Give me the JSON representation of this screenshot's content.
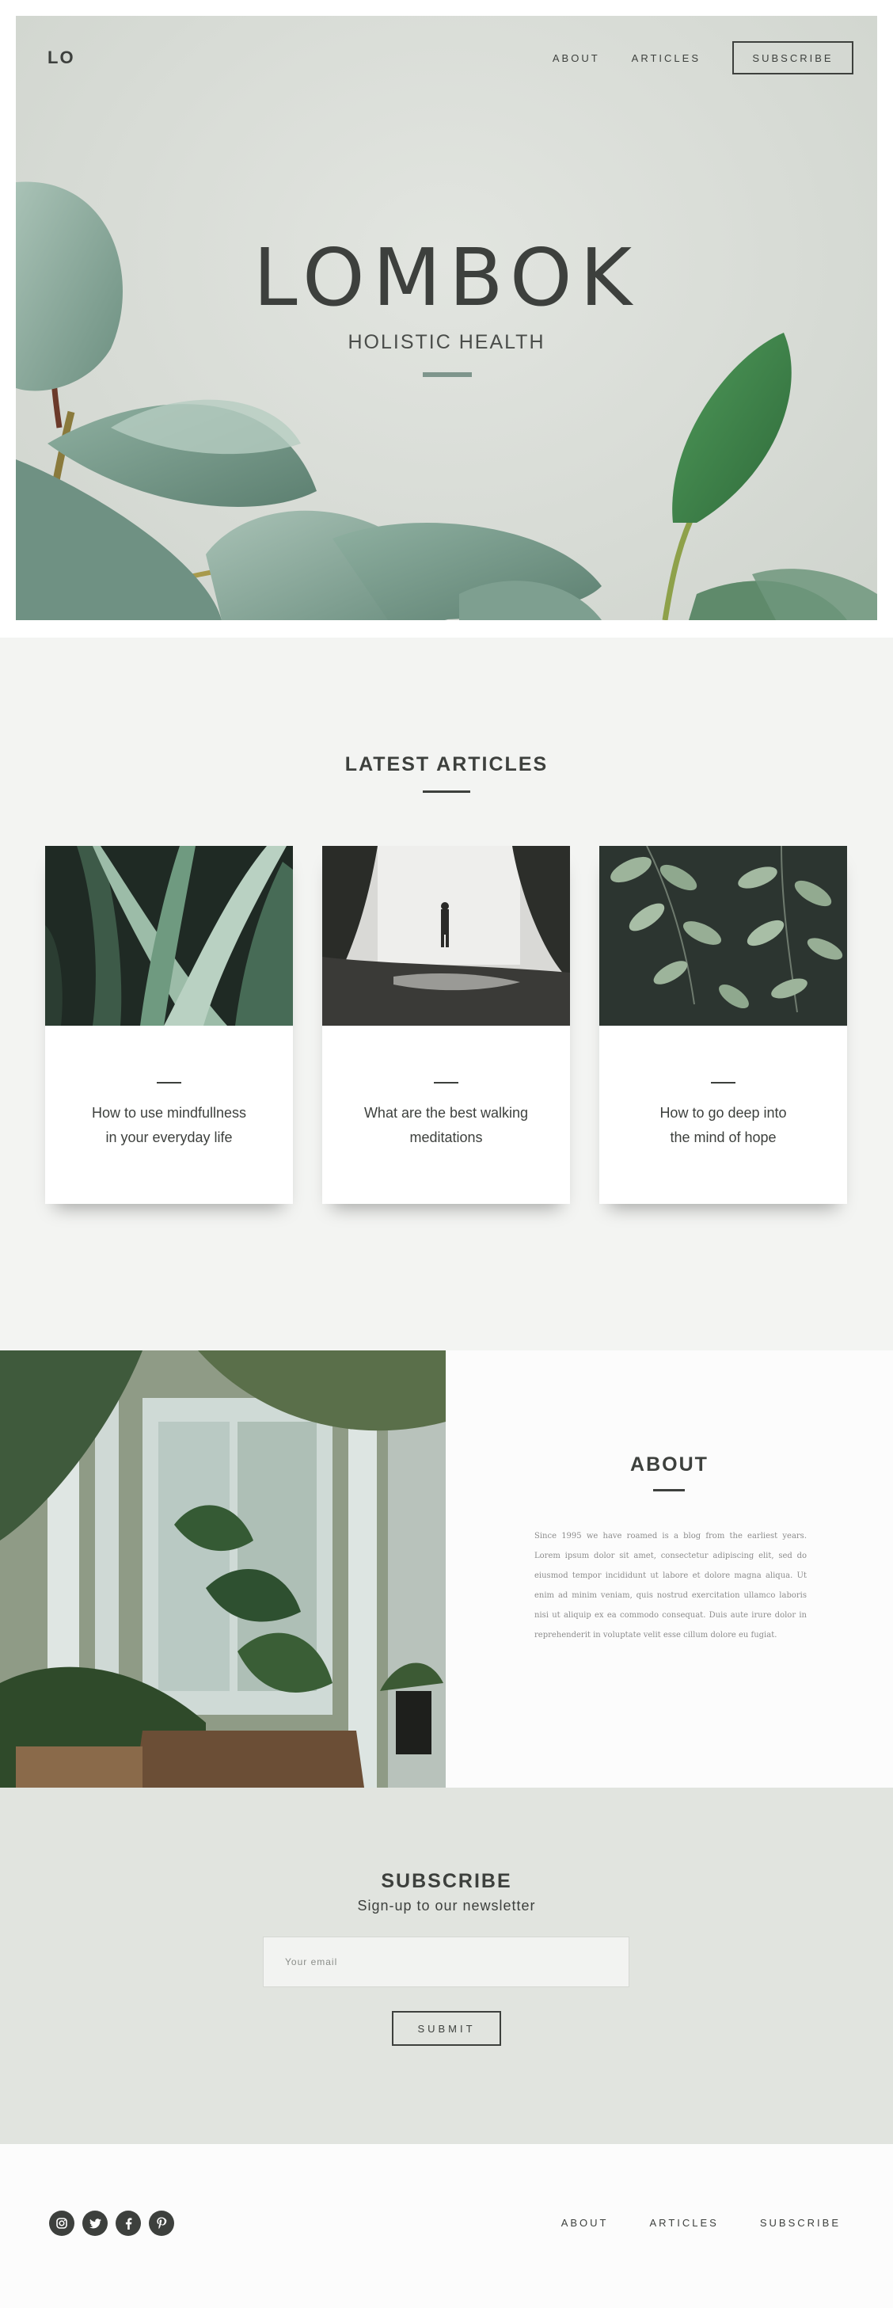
{
  "header": {
    "logo": "LO",
    "nav": [
      "ABOUT",
      "ARTICLES"
    ],
    "subscribe_label": "SUBSCRIBE"
  },
  "hero": {
    "title": "LOMBOK",
    "subtitle": "HOLISTIC HEALTH"
  },
  "articles": {
    "heading": "LATEST ARTICLES",
    "cards": [
      {
        "title_line1": "How to use mindfullness",
        "title_line2": "in your everyday life"
      },
      {
        "title_line1": "What are the best walking",
        "title_line2": "meditations"
      },
      {
        "title_line1": "How to go deep into",
        "title_line2": "the mind of hope"
      }
    ]
  },
  "about": {
    "heading": "ABOUT",
    "body": "Since 1995 we have roamed is a blog from the earliest years. Lorem ipsum dolor sit amet, consectetur adipiscing elit, sed do eiusmod tempor incididunt ut labore et dolore magna aliqua. Ut enim ad minim veniam, quis nostrud exercitation ullamco laboris nisi ut aliquip ex ea commodo consequat. Duis aute irure dolor in reprehenderit in voluptate velit esse cillum dolore eu fugiat."
  },
  "subscribe": {
    "heading": "SUBSCRIBE",
    "lede": "Sign-up to our newsletter",
    "email_placeholder": "Your email",
    "submit_label": "SUBMIT"
  },
  "footer": {
    "socials": [
      "instagram-icon",
      "twitter-icon",
      "facebook-icon",
      "pinterest-icon"
    ],
    "nav": [
      "ABOUT",
      "ARTICLES",
      "SUBSCRIBE"
    ]
  },
  "colors": {
    "text": "#3d403d",
    "accent": "#7e958c",
    "light_bg": "#f3f4f2",
    "subscribe_bg": "#e1e4df"
  }
}
